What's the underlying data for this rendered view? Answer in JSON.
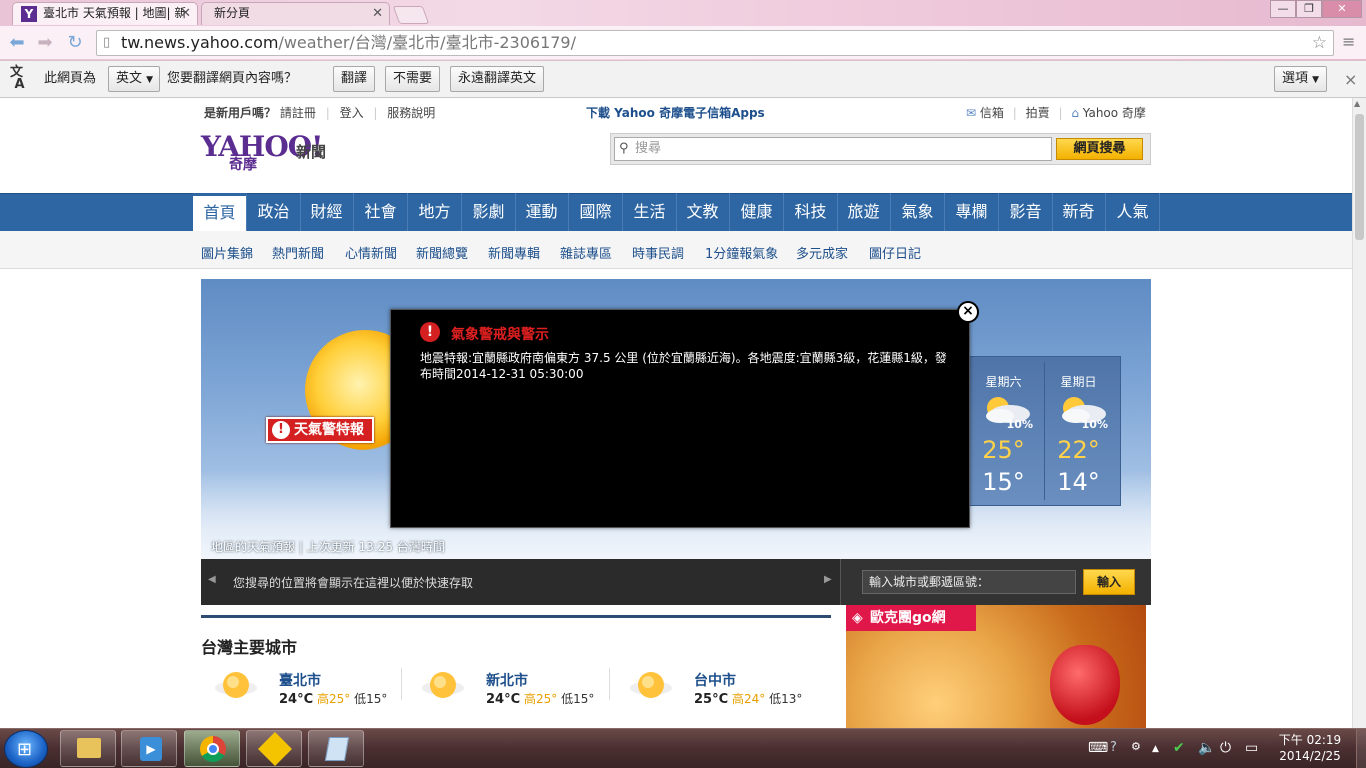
{
  "browser": {
    "tabs": [
      {
        "title": "臺北市 天氣預報 | 地圖| 新",
        "favicon": "Y"
      },
      {
        "title": "新分頁"
      }
    ],
    "url_domain": "tw.news.yahoo.com",
    "url_path": "/weather/台灣/臺北市/臺北市-2306179/",
    "window_buttons": [
      "—",
      "❐",
      "✕"
    ]
  },
  "translate_bar": {
    "prefix": "此網頁為",
    "language": "英文",
    "question": "您要翻譯網頁內容嗎？",
    "translate": "翻譯",
    "no": "不需要",
    "always": "永遠翻譯英文",
    "options": "選項",
    "close": "×"
  },
  "header": {
    "new_user": "是新用戶嗎？",
    "register": "請註冊",
    "login": "登入",
    "help": "服務說明",
    "promo": "下載 Yahoo 奇摩電子信箱Apps",
    "mail": "信箱",
    "auction": "拍賣",
    "home": "Yahoo 奇摩",
    "logo": "YAHOO!",
    "logo_sub": "奇摩",
    "logo_news": "新聞",
    "search_placeholder": "搜尋",
    "search_button": "網頁搜尋"
  },
  "nav": [
    "首頁",
    "政治",
    "財經",
    "社會",
    "地方",
    "影劇",
    "運動",
    "國際",
    "生活",
    "文教",
    "健康",
    "科技",
    "旅遊",
    "氣象",
    "專欄",
    "影音",
    "新奇",
    "人氣"
  ],
  "subnav": [
    "圖片集錦",
    "熱門新聞",
    "心情新聞",
    "新聞總覽",
    "新聞專輯",
    "雜誌專區",
    "時事民調",
    "1分鐘報氣象",
    "多元成家",
    "圖仔日記"
  ],
  "weather": {
    "alert_button": "天氣警特報",
    "caption": "地區的天氣預報 | 上次更新 13:25 台灣時間",
    "forecast": [
      {
        "day": "星期六",
        "precip": "10%",
        "high": "25°",
        "low": "15°"
      },
      {
        "day": "星期日",
        "precip": "10%",
        "high": "22°",
        "low": "14°"
      }
    ]
  },
  "modal": {
    "title": "氣象警戒與警示",
    "text": "地震特報:宜蘭縣政府南偏東方  37.5  公里 (位於宜蘭縣近海)。各地震度:宜蘭縣3級，花蓮縣1級，發布時間2014-12-31 05:30:00",
    "close": "×"
  },
  "location_bar": {
    "message": "您搜尋的位置將會顯示在這裡以便於快速存取",
    "input_placeholder": "輸入城市或郵遞區號：",
    "button": "輸入"
  },
  "cities": {
    "section_title": "台灣主要城市",
    "items": [
      {
        "name": "臺北市",
        "temp": "24°C",
        "high": "高25°",
        "low": "低15°"
      },
      {
        "name": "新北市",
        "temp": "24°C",
        "high": "高25°",
        "low": "低15°"
      },
      {
        "name": "台中市",
        "temp": "25°C",
        "high": "高24°",
        "low": "低13°"
      }
    ]
  },
  "ad": {
    "label": "歐克團go網"
  },
  "taskbar": {
    "time": "下午 02:19",
    "date": "2014/2/25"
  }
}
